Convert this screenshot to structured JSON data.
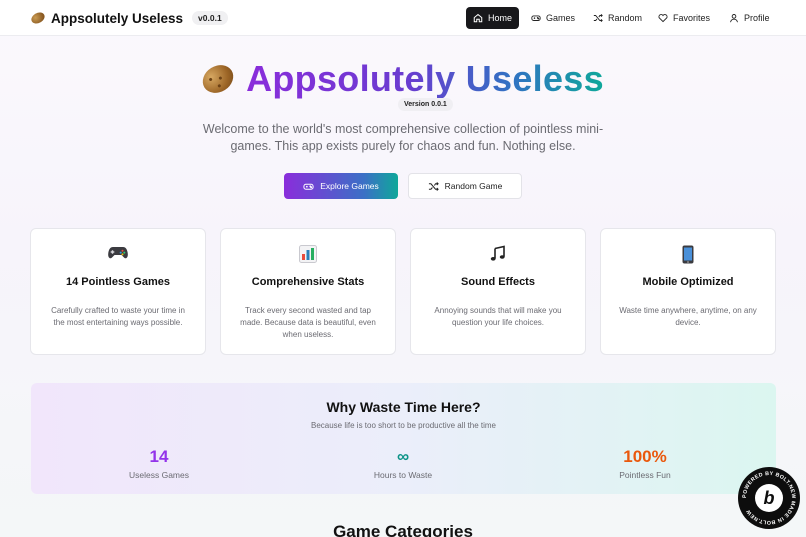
{
  "nav": {
    "brand": "Appsolutely Useless",
    "version": "v0.0.1",
    "items": [
      {
        "label": "Home",
        "icon": "home-icon",
        "active": true
      },
      {
        "label": "Games",
        "icon": "gamepad-icon",
        "active": false
      },
      {
        "label": "Random",
        "icon": "shuffle-icon",
        "active": false
      },
      {
        "label": "Favorites",
        "icon": "heart-icon",
        "active": false
      },
      {
        "label": "Profile",
        "icon": "user-icon",
        "active": false
      }
    ]
  },
  "hero": {
    "title": "Appsolutely Useless",
    "version_badge": "Version 0.0.1",
    "subtitle": "Welcome to the world's most comprehensive collection of pointless mini-games. This app exists purely for chaos and fun. Nothing else.",
    "primary_button": "Explore Games",
    "secondary_button": "Random Game"
  },
  "features": [
    {
      "icon": "gamepad-emoji-icon",
      "title": "14 Pointless Games",
      "description": "Carefully crafted to waste your time in the most entertaining ways possible."
    },
    {
      "icon": "bar-chart-icon",
      "title": "Comprehensive Stats",
      "description": "Track every second wasted and tap made. Because data is beautiful, even when useless."
    },
    {
      "icon": "music-note-icon",
      "title": "Sound Effects",
      "description": "Annoying sounds that will make you question your life choices."
    },
    {
      "icon": "mobile-phone-icon",
      "title": "Mobile Optimized",
      "description": "Waste time anywhere, anytime, on any device."
    }
  ],
  "stats_banner": {
    "title": "Why Waste Time Here?",
    "subtitle": "Because life is too short to be productive all the time",
    "stats": [
      {
        "value": "14",
        "label": "Useless Games",
        "color": "#9333ea"
      },
      {
        "value": "∞",
        "label": "Hours to Waste",
        "color": "#0d9488"
      },
      {
        "value": "100%",
        "label": "Pointless Fun",
        "color": "#ea580c"
      }
    ]
  },
  "categories": {
    "heading": "Game Categories"
  },
  "bolt_badge": {
    "ring_text": "POWERED BY BOLT.NEW MADE IN BOLT.NEW",
    "letter": "b"
  },
  "colors": {
    "gradient_start": "#8a2ddb",
    "gradient_end": "#0fa89a",
    "nav_active_bg": "#18181b"
  }
}
